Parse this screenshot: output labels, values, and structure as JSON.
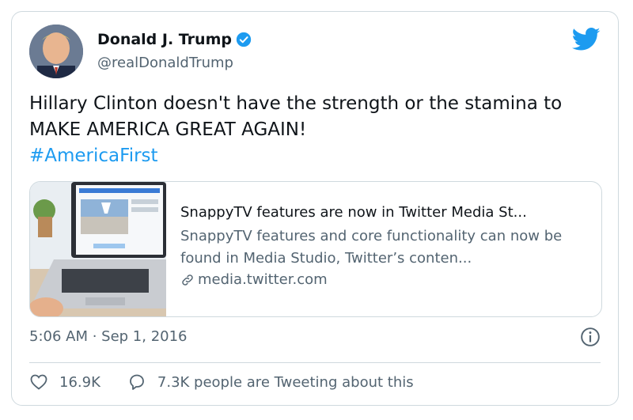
{
  "tweet": {
    "author_name": "Donald J. Trump",
    "handle": "@realDonaldTrump",
    "text_main": "Hillary Clinton doesn't have the strength or the stamina to MAKE AMERICA GREAT AGAIN!",
    "hashtag": "#AmericaFirst",
    "timestamp": "5:06 AM · Sep 1, 2016"
  },
  "link_card": {
    "title": "SnappyTV features are now in Twitter Media St...",
    "description": "SnappyTV features and core functionality can now be found in Media Studio, Twitter’s conten...",
    "domain": "media.twitter.com"
  },
  "engagement": {
    "likes": "16.9K",
    "conversation": "7.3K people are Tweeting about this"
  },
  "colors": {
    "accent": "#1d9bf0",
    "text_primary": "#0f1419",
    "text_secondary": "#536471",
    "border": "#cfd9de"
  },
  "icons": [
    "verified-badge-icon",
    "twitter-bird-icon",
    "link-icon",
    "info-icon",
    "heart-icon",
    "reply-bubble-icon"
  ]
}
